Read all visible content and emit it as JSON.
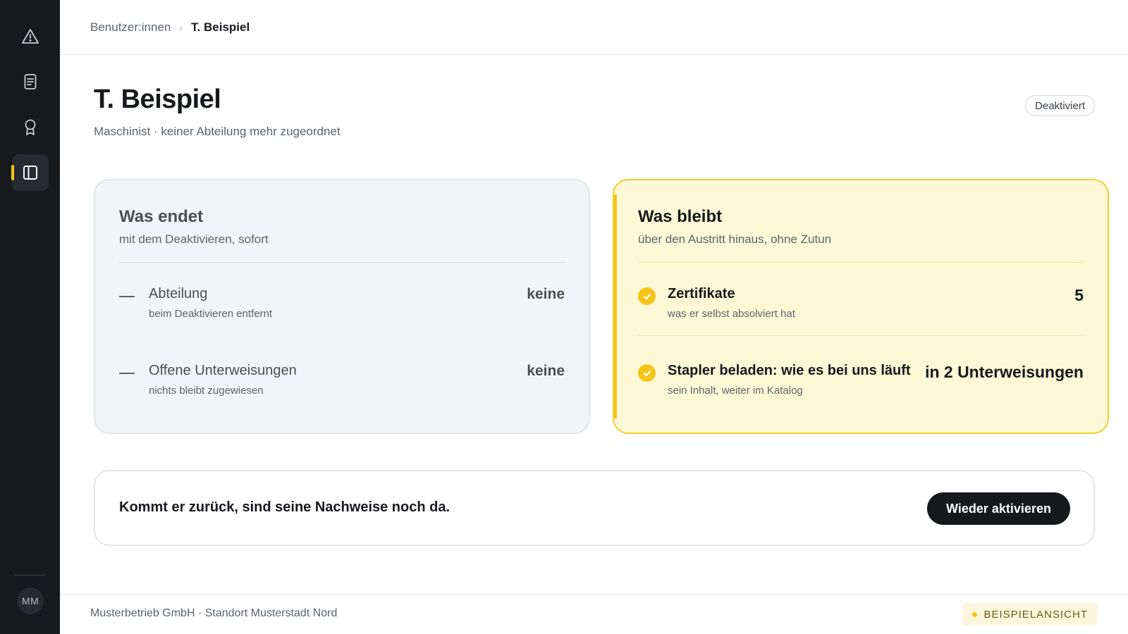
{
  "sidebar": {
    "items": [
      {
        "icon": "warning-icon",
        "active": false
      },
      {
        "icon": "document-icon",
        "active": false
      },
      {
        "icon": "award-icon",
        "active": false
      },
      {
        "icon": "sidebar-panel-icon",
        "active": true
      }
    ],
    "avatar_initials": "MM",
    "accent_color": "#f5c518"
  },
  "breadcrumb": {
    "parent": "Benutzer:innen",
    "separator": "›",
    "current": "T. Beispiel"
  },
  "header": {
    "title": "T. Beispiel",
    "subtitle": "Maschinist · keiner Abteilung mehr zugeordnet",
    "status": "Deaktiviert"
  },
  "ends_card": {
    "title": "Was endet",
    "subtitle": "mit dem Deaktivieren, sofort",
    "rows": [
      {
        "label": "Abteilung",
        "hint": "beim Deaktivieren entfernt",
        "value": "keine"
      },
      {
        "label": "Offene Unterweisungen",
        "hint": "nichts bleibt zugewiesen",
        "value": "keine"
      }
    ]
  },
  "stays_card": {
    "title": "Was bleibt",
    "subtitle": "über den Austritt hinaus, ohne Zutun",
    "rows": [
      {
        "label": "Zertifikate",
        "hint": "was er selbst absolviert hat",
        "value": "5"
      },
      {
        "label": "Stapler beladen: wie es bei uns läuft",
        "hint": "sein Inhalt, weiter im Katalog",
        "value": "in 2 Unterweisungen"
      }
    ]
  },
  "callout": {
    "text": "Kommt er zurück, sind seine Nachweise noch da.",
    "button_label": "Wieder aktivieren"
  },
  "footer": {
    "org": "Musterbetrieb GmbH · Standort Musterstadt Nord",
    "badge": "BEISPIELANSICHT"
  }
}
